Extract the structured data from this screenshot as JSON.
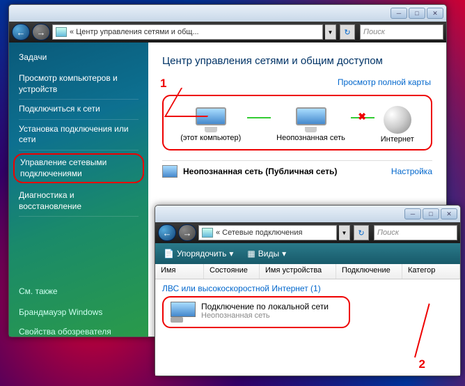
{
  "window1": {
    "breadcrumb": "« Центр управления сетями и общ...",
    "search_placeholder": "Поиск",
    "sidebar": {
      "heading": "Задачи",
      "links": [
        "Просмотр компьютеров и устройств",
        "Подключиться к сети",
        "Установка подключения или сети",
        "Управление сетевыми подключениями",
        "Диагностика и восстановление"
      ],
      "also_heading": "См. также",
      "also": [
        "Брандмауэр Windows",
        "Свойства обозревателя"
      ]
    },
    "content": {
      "title": "Центр управления сетями и общим доступом",
      "view_map": "Просмотр полной карты",
      "nodes": [
        "(этот компьютер)",
        "Неопознанная сеть",
        "Интернет"
      ],
      "netname": "Неопознанная сеть (Публичная сеть)",
      "configure": "Настройка"
    }
  },
  "window2": {
    "breadcrumb": "« Сетевые подключения",
    "search_placeholder": "Поиск",
    "toolbar": {
      "organize": "Упорядочить",
      "views": "Виды"
    },
    "columns": [
      "Имя",
      "Состояние",
      "Имя устройства",
      "Подключение",
      "Категор"
    ],
    "group": "ЛВС или высокоскоростной Интернет (1)",
    "item": {
      "name": "Подключение по локальной сети",
      "status": "Неопознанная сеть"
    }
  },
  "annotations": {
    "a1": "1",
    "a2": "2"
  }
}
